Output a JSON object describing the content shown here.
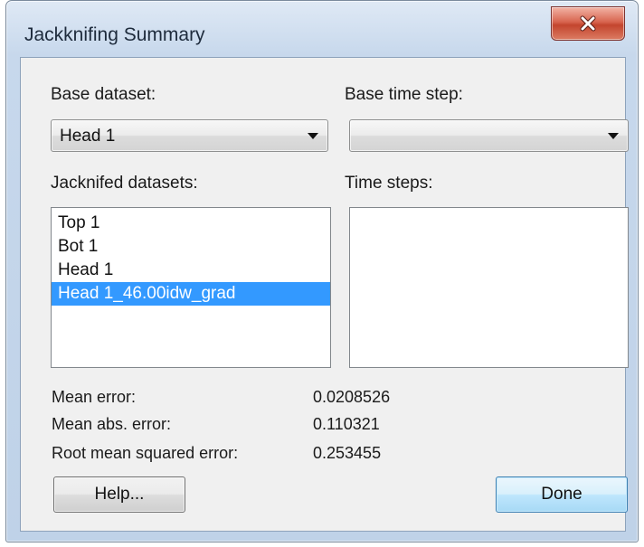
{
  "window": {
    "title": "Jackknifing Summary"
  },
  "base_dataset": {
    "label": "Base dataset:",
    "value": "Head 1"
  },
  "base_time_step": {
    "label": "Base time step:",
    "value": ""
  },
  "jacknifed_datasets": {
    "label": "Jacknifed datasets:",
    "items": [
      "Top 1",
      "Bot 1",
      "Head 1",
      "Head 1_46.00idw_grad"
    ],
    "selected_index": 3
  },
  "time_steps": {
    "label": "Time steps:",
    "items": []
  },
  "stats": {
    "mean_error_label": "Mean error:",
    "mean_error_value": "0.0208526",
    "mean_abs_error_label": "Mean abs. error:",
    "mean_abs_error_value": "0.110321",
    "rmse_label": "Root mean squared error:",
    "rmse_value": "0.253455"
  },
  "buttons": {
    "help_label": "Help...",
    "done_label": "Done"
  },
  "icons": {
    "close": "close-icon",
    "dropdown": "chevron-down-icon"
  },
  "colors": {
    "selection": "#3399ff",
    "close_button": "#c3452e",
    "default_button_border": "#3c7fb1"
  }
}
